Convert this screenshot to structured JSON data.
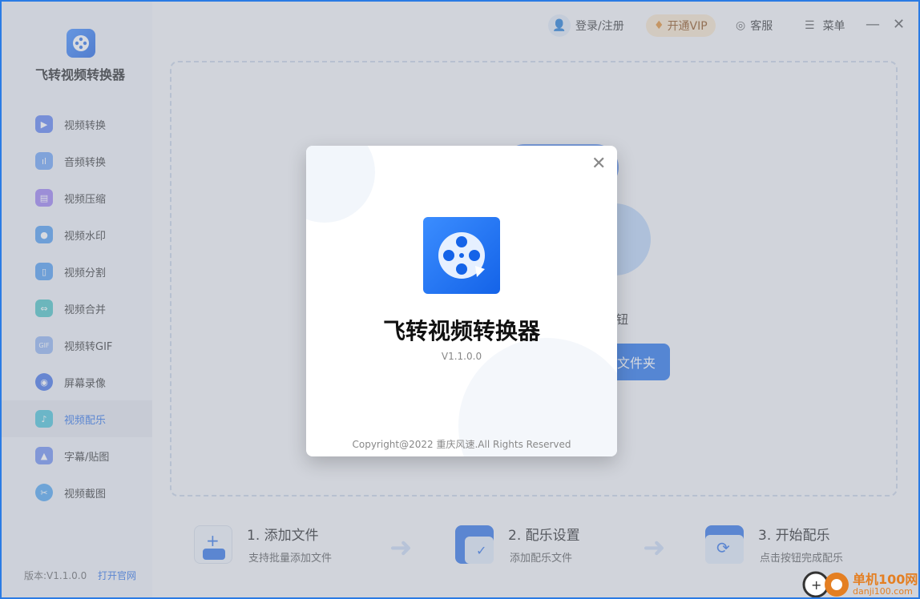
{
  "app": {
    "name": "飞转视频转换器",
    "version_footer": "版本:V1.1.0.0",
    "website_link": "打开官网"
  },
  "sidebar": {
    "items": [
      {
        "label": "视频转换",
        "icon": "video-convert-icon",
        "color": "#5b7ff0"
      },
      {
        "label": "音频转换",
        "icon": "audio-wave-icon",
        "color": "#6aa0f5"
      },
      {
        "label": "视频压缩",
        "icon": "compress-icon",
        "color": "#9a7cf0"
      },
      {
        "label": "视频水印",
        "icon": "water-drop-icon",
        "color": "#4a9af0"
      },
      {
        "label": "视频分割",
        "icon": "split-icon",
        "color": "#4a9af0"
      },
      {
        "label": "视频合并",
        "icon": "merge-icon",
        "color": "#47c2c2"
      },
      {
        "label": "视频转GIF",
        "icon": "gif-icon",
        "color": "#8fb2f0"
      },
      {
        "label": "屏幕录像",
        "icon": "record-icon",
        "color": "#3e6fe6"
      },
      {
        "label": "视频配乐",
        "icon": "music-icon",
        "color": "#46c1d6",
        "active": true
      },
      {
        "label": "字幕/贴图",
        "icon": "image-icon",
        "color": "#6b8cf0"
      },
      {
        "label": "视频截图",
        "icon": "scissors-icon",
        "color": "#4aa3f0"
      }
    ]
  },
  "topbar": {
    "login": "登录/注册",
    "vip": "开通VIP",
    "service": "客服",
    "menu": "菜单"
  },
  "dropzone": {
    "behind_text": "钮",
    "open_folder": "文件夹"
  },
  "steps": [
    {
      "title": "1. 添加文件",
      "desc": "支持批量添加文件"
    },
    {
      "title": "2. 配乐设置",
      "desc": "添加配乐文件"
    },
    {
      "title": "3. 开始配乐",
      "desc": "点击按钮完成配乐"
    }
  ],
  "modal": {
    "title": "飞转视频转换器",
    "version": "V1.1.0.0",
    "copyright": "Copyright@2022 重庆风速.All Rights Reserved"
  },
  "watermark": {
    "text": "单机100网",
    "sub": "danji100.com"
  },
  "colors": {
    "accent": "#1f6fe8",
    "window_border": "#2a7be4"
  }
}
